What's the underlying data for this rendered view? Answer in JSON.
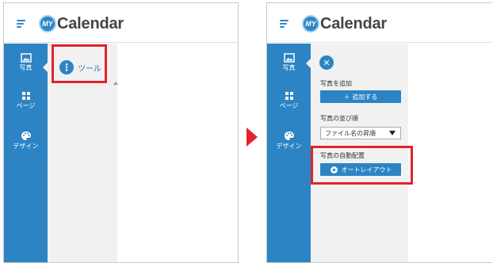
{
  "app": {
    "logo_badge": "MY",
    "logo_text": "Calendar"
  },
  "rail": {
    "items": [
      {
        "label": "写真",
        "icon": "photo-icon"
      },
      {
        "label": "ページ",
        "icon": "grid-icon"
      },
      {
        "label": "デザイン",
        "icon": "palette-icon"
      }
    ]
  },
  "before": {
    "tool_button_label": "ツール",
    "tool_button_icon": "⋮"
  },
  "after": {
    "close_icon": "✕",
    "add_photo_title": "写真を追加",
    "add_photo_button": "＋ 追加する",
    "sort_title": "写真の並び順",
    "sort_selected": "ファイル名の昇順",
    "auto_layout_title": "写真の自動配置",
    "auto_layout_button": "オートレイアウト"
  },
  "colors": {
    "accent": "#2c84c4",
    "highlight": "#e3222c",
    "drawer_bg": "#f1f1f1"
  }
}
